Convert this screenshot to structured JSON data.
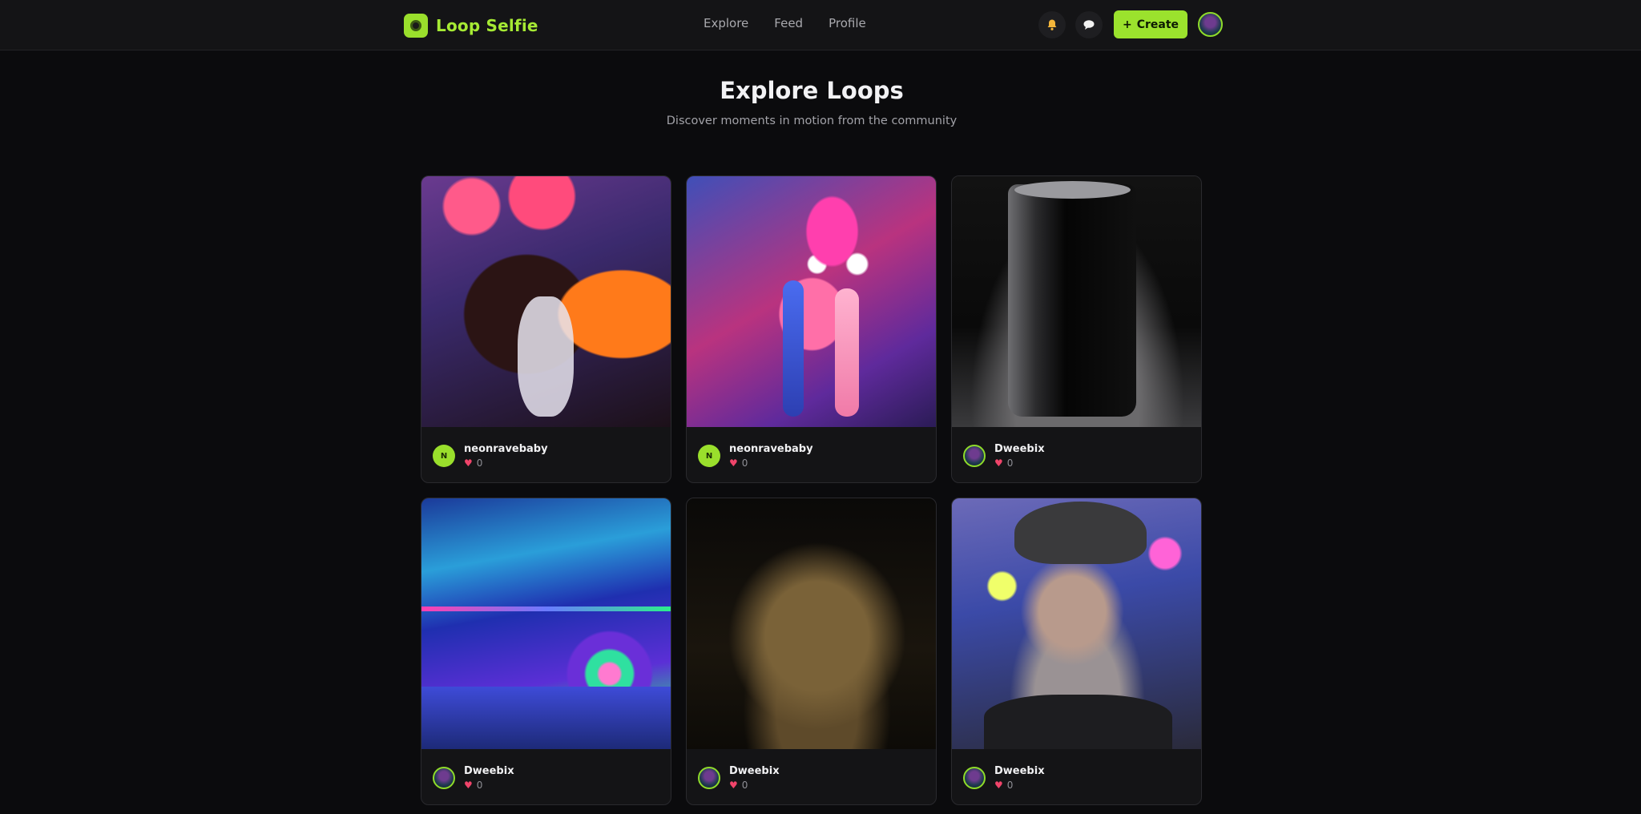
{
  "header": {
    "brand_name": "Loop Selfie",
    "nav": [
      "Explore",
      "Feed",
      "Profile"
    ],
    "notifications_icon": "bell-icon",
    "messages_icon": "chat-bubble-icon",
    "create_label": "Create",
    "create_icon": "plus-icon",
    "accent_color": "#9be22d"
  },
  "page": {
    "title": "Explore Loops",
    "subtitle": "Discover moments in motion from the community"
  },
  "loops": [
    {
      "author": "neonravebaby",
      "avatar_letter": "N",
      "likes": "0"
    },
    {
      "author": "neonravebaby",
      "avatar_letter": "N",
      "likes": "0"
    },
    {
      "author": "Dweebix",
      "avatar_letter": "",
      "likes": "0"
    },
    {
      "author": "Dweebix",
      "avatar_letter": "",
      "likes": "0"
    },
    {
      "author": "Dweebix",
      "avatar_letter": "",
      "likes": "0"
    },
    {
      "author": "Dweebix",
      "avatar_letter": "",
      "likes": "0"
    }
  ]
}
